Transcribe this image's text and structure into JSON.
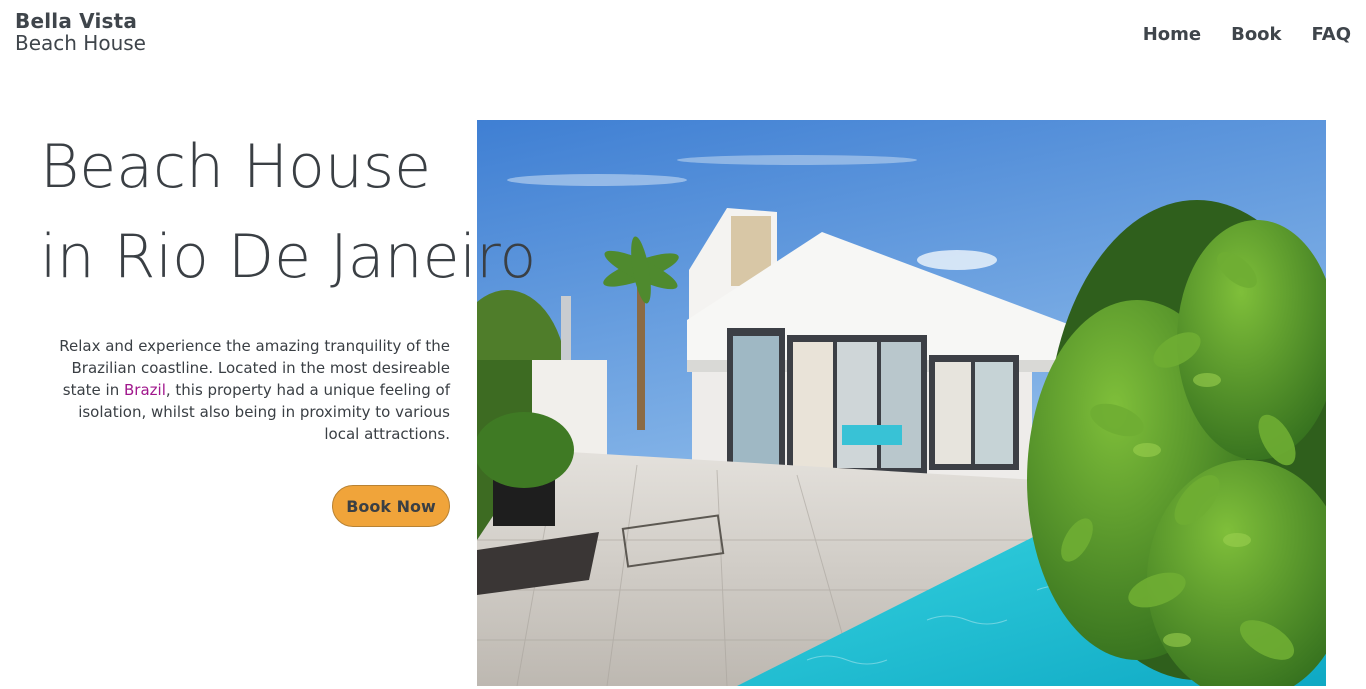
{
  "brand": {
    "name": "Bella Vista",
    "subtitle": "Beach House"
  },
  "nav": {
    "items": [
      "Home",
      "Book",
      "FAQ"
    ]
  },
  "hero": {
    "title_line1": "Beach House",
    "title_line2": "in Rio De Janeiro",
    "description_before_link": "Relax and experience the amazing tranquility of the Brazilian coastline. Located in the most desireable state in ",
    "description_link": "Brazil",
    "description_after_link": ", this property had a unique feeling of isolation, whilst also being in proximity to various local attractions.",
    "cta_label": "Book Now",
    "image_icon": "beach-house-photo"
  },
  "colors": {
    "accent": "#f0a43a",
    "link": "#a0168c",
    "text": "#3a3f44",
    "pool": "#1fc4d6",
    "sky": "#4f8fdc"
  }
}
